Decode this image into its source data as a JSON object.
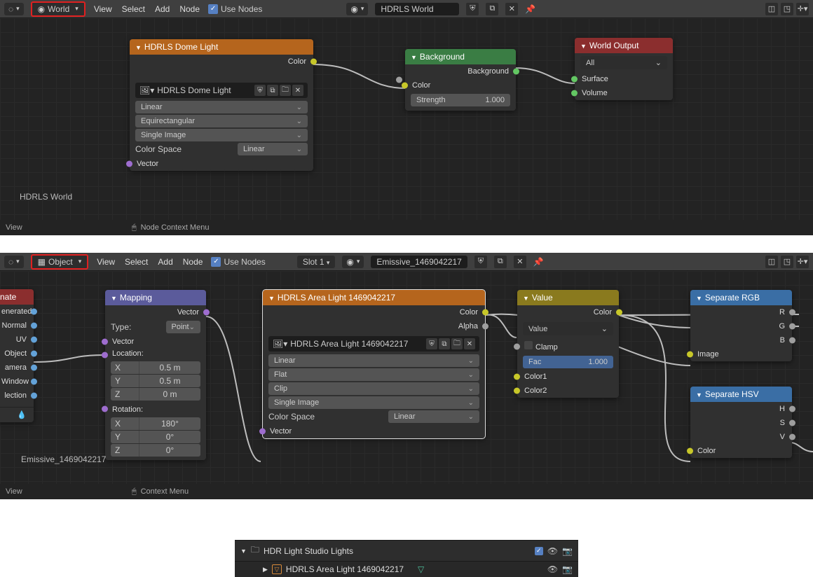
{
  "top_editor": {
    "mode": "World",
    "menus": [
      "View",
      "Select",
      "Add",
      "Node"
    ],
    "use_nodes": "Use Nodes",
    "slot": "",
    "material_name": "HDRLS World",
    "world_label_float": "HDRLS World"
  },
  "bottom_editor": {
    "mode": "Object",
    "menus": [
      "View",
      "Select",
      "Add",
      "Node"
    ],
    "use_nodes": "Use Nodes",
    "slot": "Slot 1",
    "material_name": "Emissive_1469042217",
    "label_float": "Emissive_1469042217"
  },
  "status_top": {
    "left": "View",
    "context": "Node Context Menu"
  },
  "status_bottom": {
    "left": "View",
    "context": "Context Menu"
  },
  "nodes": {
    "dome": {
      "title": "HDRLS Dome Light",
      "out_color": "Color",
      "image_name": "HDRLS Dome Light",
      "interp": "Linear",
      "proj": "Equirectangular",
      "frames": "Single Image",
      "cs_label": "Color Space",
      "cs_value": "Linear",
      "in_vector": "Vector"
    },
    "bg": {
      "title": "Background",
      "out": "Background",
      "in_color": "Color",
      "strength_label": "Strength",
      "strength_value": "1.000"
    },
    "world_out": {
      "title": "World Output",
      "target": "All",
      "surface": "Surface",
      "volume": "Volume"
    },
    "texcoord": {
      "title": "nate",
      "outs": [
        "enerated",
        "Normal",
        "UV",
        "Object",
        "amera",
        "Window",
        "lection"
      ]
    },
    "mapping": {
      "title": "Mapping",
      "out_vector": "Vector",
      "type_label": "Type:",
      "type_value": "Point",
      "in_vector": "Vector",
      "loc_label": "Location:",
      "loc": [
        [
          "X",
          "0.5 m"
        ],
        [
          "Y",
          "0.5 m"
        ],
        [
          "Z",
          "0 m"
        ]
      ],
      "rot_label": "Rotation:",
      "rot": [
        [
          "X",
          "180°"
        ],
        [
          "Y",
          "0°"
        ],
        [
          "Z",
          "0°"
        ]
      ]
    },
    "area": {
      "title": "HDRLS Area Light 1469042217",
      "out_color": "Color",
      "out_alpha": "Alpha",
      "image_name": "HDRLS Area Light 1469042217",
      "interp": "Linear",
      "proj": "Flat",
      "ext": "Clip",
      "frames": "Single Image",
      "cs_label": "Color Space",
      "cs_value": "Linear",
      "in_vector": "Vector"
    },
    "value_mix": {
      "title": "Value",
      "out_color": "Color",
      "blend": "Value",
      "clamp": "Clamp",
      "fac_label": "Fac",
      "fac_value": "1.000",
      "color1": "Color1",
      "color2": "Color2"
    },
    "sep_rgb": {
      "title": "Separate RGB",
      "R": "R",
      "G": "G",
      "B": "B",
      "image": "Image"
    },
    "sep_hsv": {
      "title": "Separate HSV",
      "H": "H",
      "S": "S",
      "V": "V",
      "color": "Color"
    }
  },
  "outliner": {
    "group": "HDR Light Studio Lights",
    "item": "HDRLS Area Light 1469042217"
  }
}
